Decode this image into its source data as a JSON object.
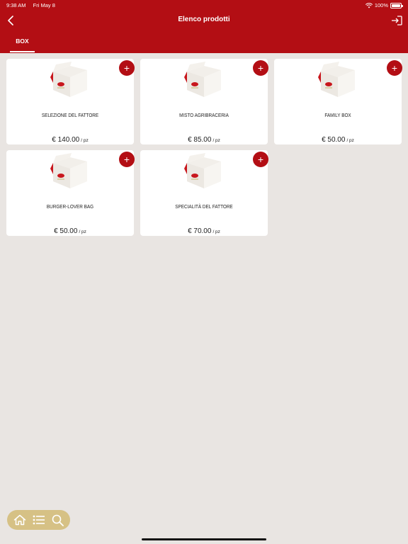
{
  "status_bar": {
    "time": "9:38 AM",
    "date": "Fri May 8",
    "battery": "100%"
  },
  "header": {
    "title": "Elenco prodotti",
    "back_icon": "chevron-left-icon",
    "login_icon": "sign-in-icon"
  },
  "tabs": [
    {
      "label": "BOX",
      "active": true
    }
  ],
  "products": [
    {
      "name": "SELEZIONE DEL FATTORE",
      "price": "€ 140.00",
      "unit": "/ pz"
    },
    {
      "name": "MISTO AGRIBRACERIA",
      "price": "€ 85.00",
      "unit": "/ pz"
    },
    {
      "name": "FAMILY BOX",
      "price": "€ 50.00",
      "unit": "/ pz"
    },
    {
      "name": "BURGER-LOVER BAG",
      "price": "€ 50.00",
      "unit": "/ pz"
    },
    {
      "name": "SPECIALITÀ DEL FATTORE",
      "price": "€ 70.00",
      "unit": "/ pz"
    }
  ],
  "add_label": "+",
  "bottom_nav": {
    "icons": [
      "home-icon",
      "list-icon",
      "search-icon"
    ]
  },
  "colors": {
    "brand": "#b30e14",
    "background": "#e9e5e2",
    "nav_pill": "#d6c185"
  }
}
